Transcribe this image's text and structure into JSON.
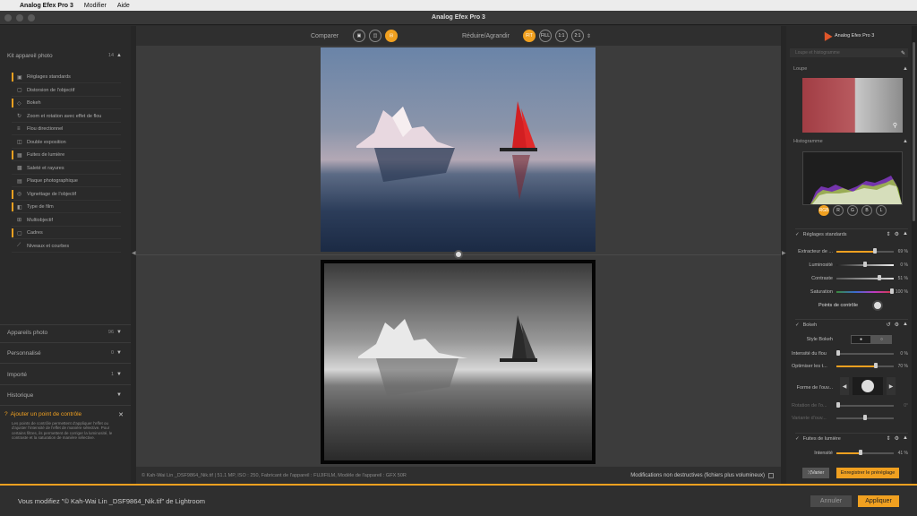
{
  "menubar": {
    "app": "Analog Efex Pro 3",
    "items": [
      "Modifier",
      "Aide"
    ]
  },
  "window": {
    "title": "Analog Efex Pro 3"
  },
  "left": {
    "kit_title": "Kit appareil photo",
    "kit_count": "14",
    "filters": [
      {
        "label": "Réglages standards",
        "active": true,
        "icon": "▣"
      },
      {
        "label": "Distorsion de l'objectif",
        "active": false,
        "icon": "▢"
      },
      {
        "label": "Bokeh",
        "active": true,
        "icon": "◇"
      },
      {
        "label": "Zoom et rotation avec effet de flou",
        "active": false,
        "icon": "↻"
      },
      {
        "label": "Flou directionnel",
        "active": false,
        "icon": "≡"
      },
      {
        "label": "Double exposition",
        "active": false,
        "icon": "◫"
      },
      {
        "label": "Fuites de lumière",
        "active": true,
        "icon": "▦"
      },
      {
        "label": "Saleté et rayures",
        "active": false,
        "icon": "▩"
      },
      {
        "label": "Plaque photographique",
        "active": false,
        "icon": "▤"
      },
      {
        "label": "Vignettage de l'objectif",
        "active": true,
        "icon": "◎"
      },
      {
        "label": "Type de film",
        "active": true,
        "icon": "◧"
      },
      {
        "label": "Multiobjectif",
        "active": false,
        "icon": "⊞"
      },
      {
        "label": "Cadres",
        "active": true,
        "icon": "▢"
      },
      {
        "label": "Niveaux et courbes",
        "active": false,
        "icon": "⟋"
      }
    ],
    "sections": [
      {
        "label": "Appareils photo",
        "count": "96"
      },
      {
        "label": "Personnalisé",
        "count": "0"
      },
      {
        "label": "Importé",
        "count": "1"
      },
      {
        "label": "Historique",
        "count": ""
      }
    ],
    "tip": {
      "title": "Ajouter un point de contrôle",
      "body": "Les points de contrôle permettent d'appliquer l'effet ou d'ajuster l'intensité de l'effet de manière sélective. Pour certains filtres, ils permettent de corriger la luminosité, le contraste et la saturation de manière sélective."
    }
  },
  "center": {
    "compare_label": "Comparer",
    "zoom_label": "Réduire/Agrandir",
    "zoom_buttons": [
      "FIT",
      "FILL",
      "1:1",
      "2:1"
    ],
    "info": "© Kah-Wai Lin _DSF9864_Nik.tif   |   51.1 MP, ISO : 250, Fabricant de l'appareil : FUJIFILM, Modèle de l'appareil : GFX 50R",
    "nondestructive": "Modifications non destructives (fichiers plus volumineux)"
  },
  "right": {
    "app_name": "Analog Efex Pro 3",
    "search_placeholder": "Loupe et histogramme",
    "loupe_label": "Loupe",
    "histo_label": "Histogramme",
    "channels": [
      "RGB",
      "R",
      "G",
      "B",
      "L"
    ],
    "std_title": "Réglages standards",
    "std_sliders": [
      {
        "label": "Extracteur de ...",
        "value": "69 %",
        "frac": 0.69
      },
      {
        "label": "Luminosité",
        "value": "0 %",
        "frac": 0.5
      },
      {
        "label": "Contraste",
        "value": "51 %",
        "frac": 0.76
      },
      {
        "label": "Saturation",
        "value": "100 %",
        "frac": 1.0
      }
    ],
    "control_points": "Points de contrôle",
    "bokeh_title": "Bokeh",
    "bokeh_style_label": "Style Bokeh",
    "bokeh_sliders": [
      {
        "label": "Intensité du flou",
        "value": "0 %",
        "frac": 0.0
      },
      {
        "label": "Optimiser les t...",
        "value": "70 %",
        "frac": 0.7
      }
    ],
    "shape_label": "Forme de l'ouv...",
    "dim_sliders": [
      {
        "label": "Rotation de l'o...",
        "value": "0°",
        "frac": 0.0
      },
      {
        "label": "Variante d'ouv...",
        "value": "",
        "frac": 0.5
      }
    ],
    "leak_title": "Fuites de lumière",
    "leak_slider": {
      "label": "Intensité",
      "value": "41 %",
      "frac": 0.41
    },
    "vary_label": "Varier",
    "save_preset_label": "Enregistrer le préréglage"
  },
  "bottom": {
    "status": "Vous modifiez \"© Kah-Wai Lin _DSF9864_Nik.tif\" de Lightroom",
    "cancel": "Annuler",
    "apply": "Appliquer"
  },
  "colors": {
    "accent": "#f0a020"
  }
}
